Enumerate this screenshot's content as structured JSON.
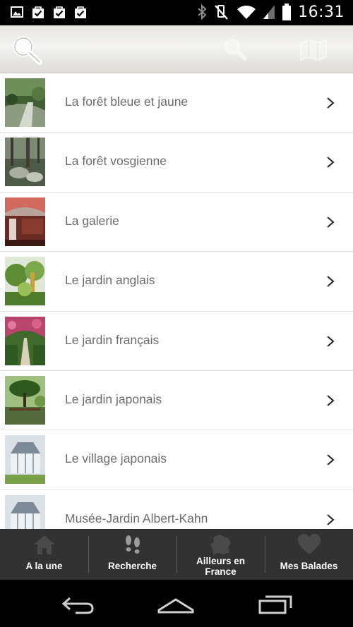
{
  "status_bar": {
    "time": "16:31",
    "left_icons": [
      "image-icon",
      "check-bag-icon",
      "check-bag-icon",
      "check-bag-icon"
    ],
    "right_icons": [
      "bluetooth-icon",
      "mute-icon",
      "wifi-icon",
      "signal-icon",
      "battery-icon"
    ]
  },
  "action_bar": {
    "icons": [
      "search-icon",
      "search-icon",
      "map-icon"
    ]
  },
  "list": {
    "items": [
      {
        "label": "La forêt bleue et jaune",
        "thumb": "garden-path-thumb"
      },
      {
        "label": "La forêt vosgienne",
        "thumb": "forest-rocks-thumb"
      },
      {
        "label": "La galerie",
        "thumb": "gallery-thumb"
      },
      {
        "label": "Le jardin anglais",
        "thumb": "english-garden-thumb"
      },
      {
        "label": "Le jardin français",
        "thumb": "french-garden-thumb"
      },
      {
        "label": "Le jardin japonais",
        "thumb": "japanese-garden-thumb"
      },
      {
        "label": "Le village japonais",
        "thumb": "greenhouse-thumb"
      },
      {
        "label": "Musée-Jardin Albert-Kahn",
        "thumb": "greenhouse-thumb"
      }
    ]
  },
  "tabbar": {
    "tabs": [
      {
        "label": "A la une",
        "icon": "home-icon"
      },
      {
        "label": "Recherche",
        "icon": "footprints-icon"
      },
      {
        "label": "Ailleurs en France",
        "icon": "france-map-icon"
      },
      {
        "label": "Mes Balades",
        "icon": "heart-icon"
      }
    ]
  },
  "colors": {
    "tabbar_bg": "#323232",
    "label_text": "#6b6b6b",
    "action_bar": "#eeede8"
  }
}
